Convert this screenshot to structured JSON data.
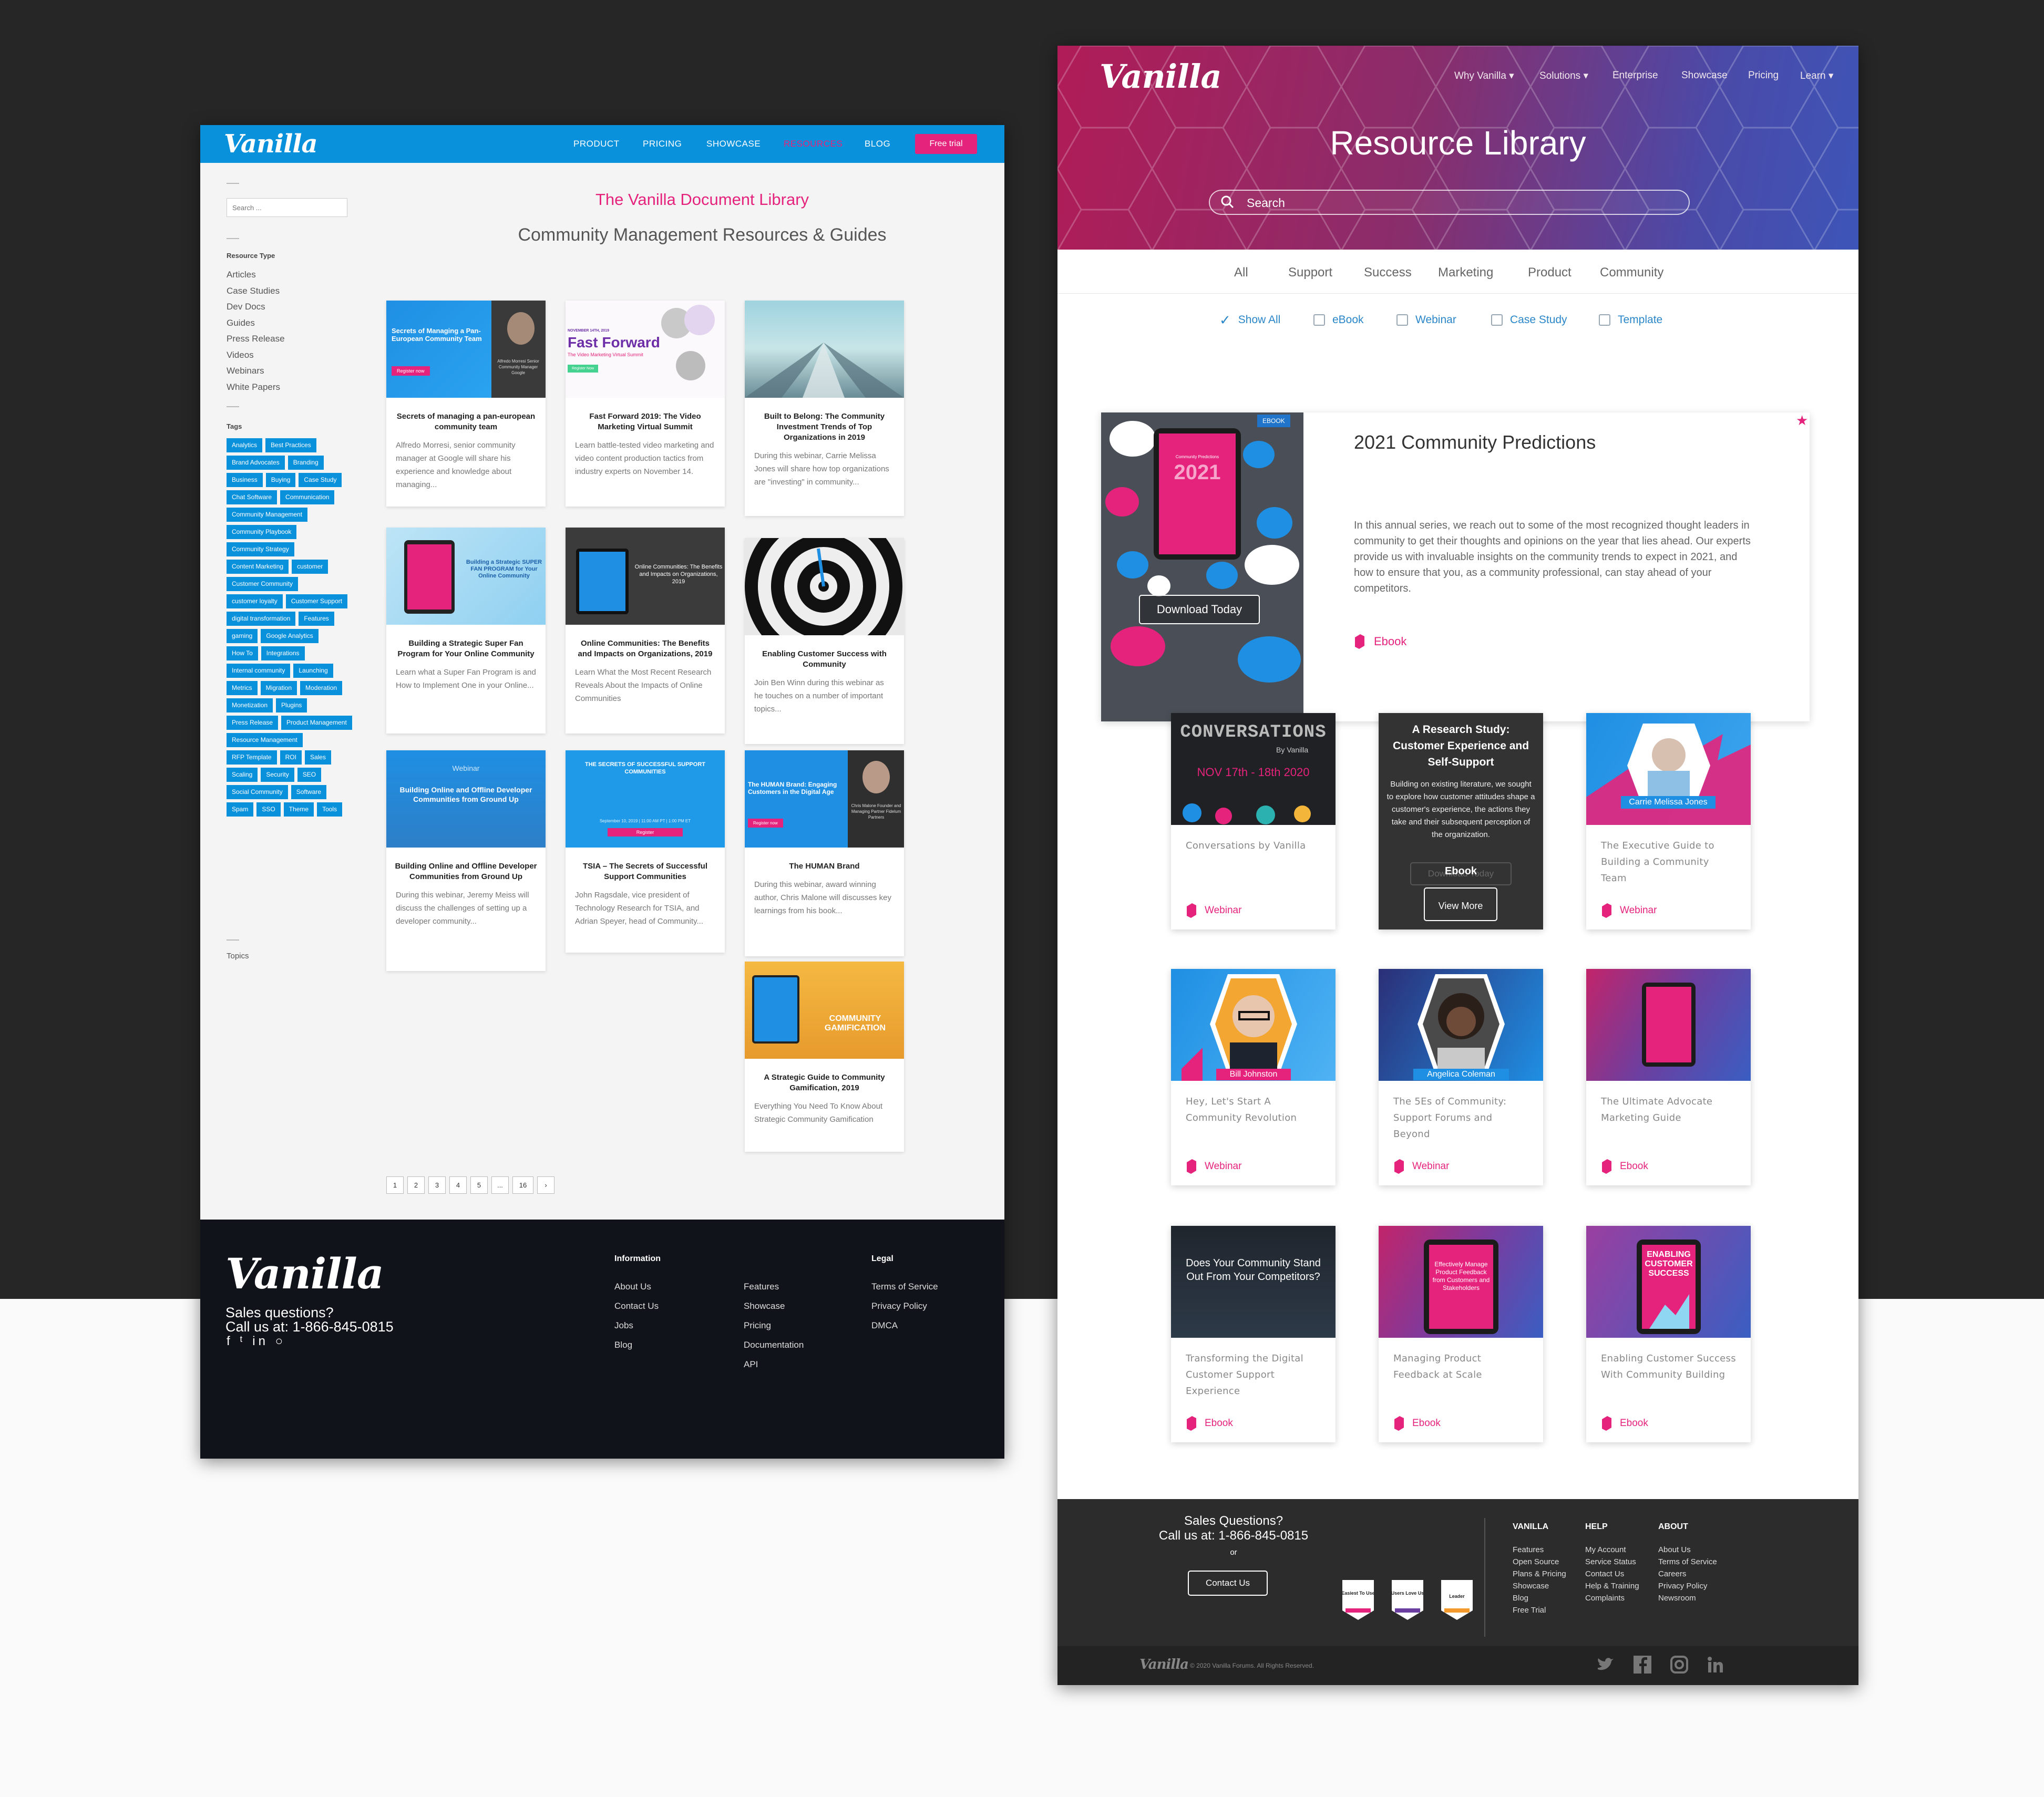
{
  "left": {
    "logo": "Vanilla",
    "nav": [
      "PRODUCT",
      "PRICING",
      "SHOWCASE",
      "RESOURCES",
      "BLOG"
    ],
    "free_trial": "Free trial",
    "search_placeholder": "Search ...",
    "resource_type_heading": "Resource Type",
    "resource_types": [
      "Articles",
      "Case Studies",
      "Dev Docs",
      "Guides",
      "Press Release",
      "Videos",
      "Webinars",
      "White Papers"
    ],
    "tags_heading": "Tags",
    "tags": [
      "Analytics",
      "Best Practices",
      "Brand Advocates",
      "Branding",
      "Business",
      "Buying",
      "Case Study",
      "Chat Software",
      "Communication",
      "Community Management",
      "Community Playbook",
      "Community Strategy",
      "Content Marketing",
      "customer",
      "Customer Community",
      "customer loyalty",
      "Customer Support",
      "digital transformation",
      "Features",
      "gaming",
      "Google Analytics",
      "How To",
      "Integrations",
      "Internal community",
      "Launching",
      "Metrics",
      "Migration",
      "Moderation",
      "Monetization",
      "Plugins",
      "Press Release",
      "Product Management",
      "Resource Management",
      "RFP Template",
      "ROI",
      "Sales",
      "Scaling",
      "Security",
      "SEO",
      "Social Community",
      "Software",
      "Spam",
      "SSO",
      "Theme",
      "Tools"
    ],
    "topics_heading": "Topics",
    "title": "The Vanilla Document Library",
    "subtitle": "Community Management Resources & Guides",
    "cards": [
      {
        "title": "Secrets of managing a pan-european community team",
        "desc": "Alfredo Morresi, senior community manager at Google will share his experience and knowledge about managing...",
        "thumb_text": "Secrets of Managing a Pan-European Community Team",
        "thumb_btn": "Register now",
        "thumb_caption": "Alfredo Morresi Senior Community Manager Google"
      },
      {
        "title": "Fast Forward 2019: The Video Marketing Virtual Summit",
        "desc": "Learn battle-tested video marketing and video content production tactics from industry experts on November 14.",
        "thumb_text": "Fast Forward",
        "thumb_sub": "The Video Marketing Virtual Summit",
        "thumb_date": "NOVEMBER 14TH, 2019",
        "thumb_btn": "Register Now"
      },
      {
        "title": "Built to Belong: The Community Investment Trends of Top Organizations in 2019",
        "desc": "During this webinar, Carrie Melissa Jones will share how top organizations are \"investing\" in community..."
      },
      {
        "title": "Building a Strategic Super Fan Program for Your Online Community",
        "desc": "Learn what a Super Fan Program is and How to Implement One in your Online...",
        "thumb_text": "Building a Strategic SUPER FAN PROGRAM for Your Online Community"
      },
      {
        "title": "Online Communities: The Benefits and Impacts on Organizations, 2019",
        "desc": "Learn What the Most Recent Research Reveals About the Impacts of Online Communities",
        "thumb_text": "Online Communities: The Benefits and Impacts on Organizations, 2019"
      },
      {
        "title": "Enabling Customer Success with Community",
        "desc": "Join Ben Winn during this webinar as he touches on a number of important topics..."
      },
      {
        "title": "Building Online and Offline Developer Communities from Ground Up",
        "desc": "During this webinar, Jeremy Meiss will discuss the challenges of setting up a developer community...",
        "thumb_label": "Webinar",
        "thumb_text": "Building Online and Offline Developer Communities from Ground Up"
      },
      {
        "title": "TSIA – The Secrets of Successful Support Communities",
        "desc": "John Ragsdale, vice president of Technology Research for TSIA, and Adrian Speyer, head of Community...",
        "thumb_text": "THE SECRETS OF SUCCESSFUL SUPPORT COMMUNITIES",
        "thumb_date": "September 10, 2019 | 11:00 AM PT | 1:00 PM ET",
        "thumb_btn": "Register"
      },
      {
        "title": "The HUMAN Brand",
        "desc": "During this webinar, award winning author, Chris Malone will discusses key learnings from his book...",
        "thumb_text": "The HUMAN Brand: Engaging Customers in the Digital Age",
        "thumb_btn": "Register now",
        "thumb_caption": "Chris Malone Founder and Managing Partner Fidelum Partners"
      },
      {
        "title": "A Strategic Guide to Community Gamification, 2019",
        "desc": "Everything You Need To Know About Strategic Community Gamification",
        "thumb_text": "COMMUNITY GAMIFICATION"
      }
    ],
    "pagination": [
      "1",
      "2",
      "3",
      "4",
      "5",
      "...",
      "16",
      "›"
    ],
    "footer": {
      "logo": "Vanilla",
      "sales_line1": "Sales questions?",
      "sales_line2": "Call us at: 1-866-845-0815",
      "social": "f ᵗ in ○",
      "info_heading": "Information",
      "info_col1": [
        "About Us",
        "Contact Us",
        "Jobs",
        "Blog"
      ],
      "info_col2": [
        "Features",
        "Showcase",
        "Pricing",
        "Documentation",
        "API"
      ],
      "legal_heading": "Legal",
      "legal": [
        "Terms of Service",
        "Privacy Policy",
        "DMCA"
      ]
    }
  },
  "right": {
    "logo": "Vanilla",
    "nav": [
      "Why Vanilla ▾",
      "Solutions ▾",
      "Enterprise",
      "Showcase",
      "Pricing",
      "Learn ▾"
    ],
    "hero_title": "Resource Library",
    "search_placeholder": "Search",
    "categories": [
      "All",
      "Support",
      "Success",
      "Marketing",
      "Product",
      "Community"
    ],
    "filters": [
      {
        "label": "Show All",
        "checked": true
      },
      {
        "label": "eBook",
        "checked": false
      },
      {
        "label": "Webinar",
        "checked": false
      },
      {
        "label": "Case Study",
        "checked": false
      },
      {
        "label": "Template",
        "checked": false
      }
    ],
    "featured": {
      "badge": "EBOOK",
      "tablet_year": "2021",
      "tablet_title": "Community Predictions",
      "button": "Download Today",
      "title": "2021 Community Predictions",
      "desc": "In this annual series, we reach out to some of the most recognized thought leaders in community to get their thoughts and opinions on the year that lies ahead. Our experts provide us with invaluable insights on the community trends to expect in 2021, and how to ensure that you, as a community professional, can stay ahead of your competitors.",
      "type": "Ebook",
      "star": "★"
    },
    "cards": [
      {
        "title": "Conversations by Vanilla",
        "type": "Webinar",
        "thumb_title": "CONVERSATIONS",
        "thumb_by": "By Vanilla",
        "thumb_date": "NOV 17th - 18th 2020"
      },
      {
        "title": "A Research Study: Customer Experience and Self-Support",
        "type": "Ebook",
        "hover": true,
        "hover_desc": "Building on existing literature, we sought to explore how customer attitudes shape a customer's experience, the actions they take and their subsequent perception of the organization.",
        "ghost": "Download Today",
        "view_more": "View More"
      },
      {
        "title": "The Executive Guide to Building a Community Team",
        "type": "Webinar",
        "thumb_name": "Carrie Melissa Jones"
      },
      {
        "title": "Hey, Let's Start A Community Revolution",
        "type": "Webinar",
        "thumb_name": "Bill Johnston"
      },
      {
        "title": "The 5Es of Community: Support Forums and Beyond",
        "type": "Webinar",
        "thumb_name": "Angelica Coleman"
      },
      {
        "title": "The Ultimate Advocate Marketing Guide",
        "type": "Ebook"
      },
      {
        "title": "Transforming the Digital Customer Support Experience",
        "type": "Ebook",
        "thumb_text": "Does Your Community Stand Out From Your Competitors?"
      },
      {
        "title": "Managing Product Feedback at Scale",
        "type": "Ebook",
        "thumb_text": "Effectively Manage Product Feedback from Customers and Stakeholders"
      },
      {
        "title": "Enabling Customer Success With Community Building",
        "type": "Ebook",
        "thumb_text": "ENABLING CUSTOMER SUCCESS"
      }
    ],
    "footer": {
      "sales_heading": "Sales Questions?",
      "sales_phone": "Call us at: 1-866-845-0815",
      "or": "or",
      "contact_btn": "Contact Us",
      "badges": [
        "Easiest To Use",
        "Users Love Us",
        "Leader"
      ],
      "badge_year": "2020",
      "col1_heading": "VANILLA",
      "col1": [
        "Features",
        "Open Source",
        "Plans & Pricing",
        "Showcase",
        "Blog",
        "Free Trial"
      ],
      "col2_heading": "HELP",
      "col2": [
        "My Account",
        "Service Status",
        "Contact Us",
        "Help & Training",
        "Complaints"
      ],
      "col3_heading": "ABOUT",
      "col3": [
        "About Us",
        "Terms of Service",
        "Careers",
        "Privacy Policy",
        "Newsroom"
      ],
      "bottom_logo": "Vanilla",
      "copyright": "© 2020 Vanilla Forums. All Rights Reserved."
    }
  },
  "colors": {
    "pink": "#e5237c",
    "blue": "#0a91dc",
    "dark": "#262626"
  }
}
